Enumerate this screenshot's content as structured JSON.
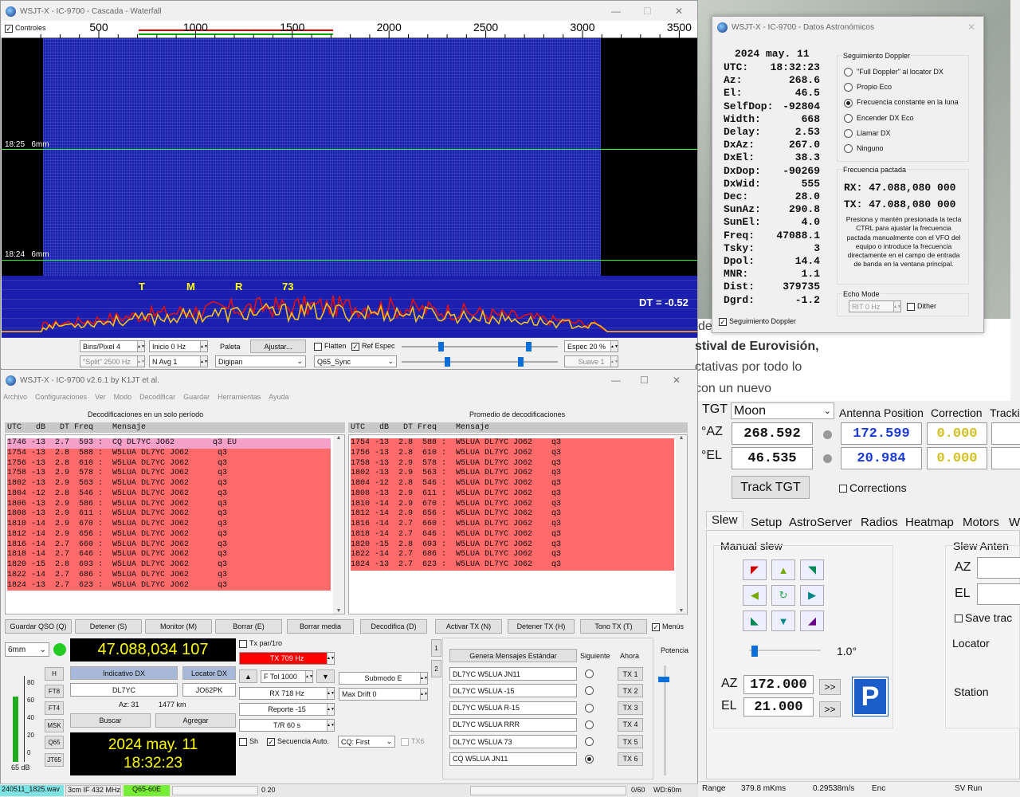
{
  "waterfall": {
    "title": "WSJT-X - IC-9700 - Cascada - Waterfall",
    "controls_label": "Controles",
    "freq_ticks": [
      "500",
      "1000",
      "1500",
      "2000",
      "2500",
      "3000",
      "3500"
    ],
    "time_marks": [
      {
        "time": "18:25",
        "band": "6mm"
      },
      {
        "time": "18:24",
        "band": "6mm"
      }
    ],
    "markers": [
      "T",
      "M",
      "R",
      "73"
    ],
    "dt_label": "DT =",
    "dt_value": "-0.52",
    "bins_pixel": "Bins/Pixel  4",
    "inicio": "Inicio 0 Hz",
    "split": "\"Split\"  2500  Hz",
    "navg": "N Avg 1",
    "paleta": "Paleta",
    "ajustar": "Ajustar...",
    "palette_value": "Digipan",
    "flatten": "Flatten",
    "ref_espec": "Ref Espec",
    "mode_value": "Q65_Sync",
    "espec": "Espec 20 %",
    "suave": "Suave  1",
    "colors": {
      "bg": "#1a1fae",
      "spectrum_red": "#e01010",
      "spectrum_yellow": "#f0c020"
    }
  },
  "astro": {
    "title": "WSJT-X - IC-9700 - Datos Astronómicos",
    "date": "2024 may. 11",
    "rows": [
      [
        "UTC:",
        "18:32:23"
      ],
      [
        "Az:",
        "268.6"
      ],
      [
        "El:",
        "46.5"
      ],
      [
        "SelfDop:",
        "-92804"
      ],
      [
        "Width:",
        "668"
      ],
      [
        "Delay:",
        "2.53"
      ],
      [
        "DxAz:",
        "267.0"
      ],
      [
        "DxEl:",
        "38.3"
      ],
      [
        "DxDop:",
        "-90269"
      ],
      [
        "DxWid:",
        "555"
      ],
      [
        "Dec:",
        "28.0"
      ],
      [
        "SunAz:",
        "290.8"
      ],
      [
        "SunEl:",
        "4.0"
      ],
      [
        "Freq:",
        "47088.1"
      ],
      [
        "Tsky:",
        "3"
      ],
      [
        "Dpol:",
        "14.4"
      ],
      [
        "MNR:",
        "1.1"
      ],
      [
        "Dist:",
        "379735"
      ],
      [
        "Dgrd:",
        "-1.2"
      ]
    ],
    "doppler_group": "Seguimiento Doppler",
    "doppler_options": [
      "\"Full Doppler\" al locator DX",
      "Propio Eco",
      "Frecuencia constante en la luna",
      "Encender DX Eco",
      "Llamar DX",
      "Ninguno"
    ],
    "doppler_selected": 2,
    "freq_group": "Frecuencia pactada",
    "rx": "RX: 47.088,080 000",
    "tx": "TX: 47.088,080 000",
    "note": "Presiona y mantén presionada la tecla CTRL para ajustar la frecuencia pactada manualmente con el VFO del equipo o introduce la frecuencia directamente en el campo de entrada de banda en la ventana principal.",
    "echo_group": "Echo Mode",
    "rit": "RIT  0  Hz",
    "dither": "Dither",
    "seguimiento": "Seguimiento Doppler"
  },
  "browser_text": {
    "lines": [
      "de",
      "stival de Eurovisión,",
      "ctativas por todo lo",
      "con un nuevo"
    ]
  },
  "main": {
    "title": "WSJT-X - IC-9700   v2.6.1   by K1JT et al.",
    "menu": [
      "Archivo",
      "Configuraciones",
      "Ver",
      "Modo",
      "Decodificar",
      "Guardar",
      "Herramientas",
      "Ayuda"
    ],
    "left_header": "Decodificaciones en un solo período",
    "right_header": "Promedio de decodificaciones",
    "col_header": "UTC   dB   DT Freq    Mensaje",
    "left_rows": [
      {
        "t": "1746 -13  2.7  593 :  CQ DL7YC JO62        q3 EU",
        "cq": true
      },
      {
        "t": "1754 -13  2.8  588 :  W5LUA DL7YC JO62      q3"
      },
      {
        "t": "1756 -13  2.8  610 :  W5LUA DL7YC JO62      q3"
      },
      {
        "t": "1758 -13  2.9  578 :  W5LUA DL7YC JO62      q3"
      },
      {
        "t": "1802 -13  2.9  563 :  W5LUA DL7YC JO62      q3"
      },
      {
        "t": "1804 -12  2.8  546 :  W5LUA DL7YC JO62      q3"
      },
      {
        "t": "1806 -13  2.9  586 :  W5LUA DL7YC JO62      q3"
      },
      {
        "t": "1808 -13  2.9  611 :  W5LUA DL7YC JO62      q3"
      },
      {
        "t": "1810 -14  2.9  670 :  W5LUA DL7YC JO62      q3"
      },
      {
        "t": "1812 -14  2.9  656 :  W5LUA DL7YC JO62      q3"
      },
      {
        "t": "1816 -14  2.7  660 :  W5LUA DL7YC JO62      q3"
      },
      {
        "t": "1818 -14  2.7  646 :  W5LUA DL7YC JO62      q3"
      },
      {
        "t": "1820 -15  2.8  693 :  W5LUA DL7YC JO62      q3"
      },
      {
        "t": "1822 -14  2.7  686 :  W5LUA DL7YC JO62      q3"
      },
      {
        "t": "1824 -13  2.7  623 :  W5LUA DL7YC JO62      q3"
      }
    ],
    "right_rows": [
      "1754 -13  2.8  588 :  W5LUA DL7YC JO62    q3",
      "1756 -13  2.8  610 :  W5LUA DL7YC JO62    q3",
      "1758 -13  2.9  578 :  W5LUA DL7YC JO62    q3",
      "1802 -13  2.9  563 :  W5LUA DL7YC JO62    q3",
      "1804 -12  2.8  546 :  W5LUA DL7YC JO62    q3",
      "1808 -13  2.9  611 :  W5LUA DL7YC JO62    q3",
      "1810 -14  2.9  670 :  W5LUA DL7YC JO62    q3",
      "1812 -14  2.9  656 :  W5LUA DL7YC JO62    q3",
      "1816 -14  2.7  660 :  W5LUA DL7YC JO62    q3",
      "1818 -14  2.7  646 :  W5LUA DL7YC JO62    q3",
      "1820 -15  2.8  693 :  W5LUA DL7YC JO62    q3",
      "1822 -14  2.7  686 :  W5LUA DL7YC JO62    q3",
      "1824 -13  2.7  623 :  W5LUA DL7YC JO62    q3"
    ],
    "buttons": [
      "Guardar QSO (Q)",
      "Detener (S)",
      "Monitor (M)",
      "Borrar (E)",
      "Borrar media",
      "Decodifica (D)",
      "Activar TX (N)",
      "Detener TX (H)",
      "Tono TX (T)"
    ],
    "menus_label": "Menús",
    "band": "6mm",
    "frequency": "47.088,034 107",
    "indicativo_dx": "Indicativo DX",
    "locator_dx": "Locator DX",
    "dx_call": "DL7YC",
    "dx_grid": "JO62PK",
    "az": "Az: 31",
    "km": "1477 km",
    "buscar": "Buscar",
    "agregar": "Agregar",
    "date": "2024 may. 11",
    "time": "18:32:23",
    "side_btns": [
      "H",
      "FT8",
      "FT4",
      "MSK",
      "Q65",
      "JT65"
    ],
    "meter_ticks": [
      "80",
      "60",
      "40",
      "20",
      "0"
    ],
    "meter_db": "65 dB",
    "tx_par": "Tx par/1ro",
    "tx_hz": "TX  709  Hz",
    "ftol": "F Tol  1000",
    "rx_hz": "RX  718  Hz",
    "reporte": "Reporte -15",
    "tr": "T/R  60  s",
    "submodo": "Submodo E",
    "maxdrift": "Max Drift  0",
    "sh": "Sh",
    "secuencia": "Secuencia Auto.",
    "cq_first": "CQ: First",
    "tx6_chk": "TX6",
    "tab1": "1",
    "tab2": "2",
    "genera": "Genera Mensajes Estándar",
    "siguiente": "Siguiente",
    "ahora": "Ahora",
    "messages": [
      "DL7YC W5LUA JN11",
      "DL7YC W5LUA -15",
      "DL7YC W5LUA R-15",
      "DL7YC W5LUA RRR",
      "DL7YC W5LUA 73",
      "CQ W5LUA JN11"
    ],
    "tx_btns": [
      "TX 1",
      "TX 2",
      "TX 3",
      "TX 4",
      "TX 5",
      "TX 6"
    ],
    "selected_msg": 5,
    "potencia": "Potencia",
    "status": {
      "file": "240511_1825.wav",
      "if": "3cm IF 432 MHz",
      "mode": "Q65-60E",
      "count": "0  20",
      "progress": "0/60",
      "wd": "WD:60m"
    }
  },
  "tracker": {
    "tgt_label": "TGT",
    "tgt_value": "Moon",
    "antenna_position": "Antenna Position",
    "correction": "Correction",
    "tracking": "Trackin",
    "az_label": "°AZ",
    "el_label": "°EL",
    "az_val": "268.592",
    "el_val": "46.535",
    "az_pos": "172.599",
    "el_pos": "20.984",
    "az_corr": "0.000",
    "el_corr": "0.000",
    "track_btn": "Track TGT",
    "corrections": "Corrections",
    "tabs": [
      "Slew",
      "Setup",
      "AstroServer",
      "Radios",
      "Heatmap",
      "Motors",
      "W"
    ],
    "manual_slew": "Manual slew",
    "step": "1.0°",
    "az_set": "172.000",
    "el_set": "21.000",
    "az_lbl": "AZ",
    "el_lbl": "EL",
    "slew_antenna": "Slew Anten",
    "save_track": "Save trac",
    "locator": "Locator",
    "station": "Station",
    "status": {
      "range_label": "Range",
      "range": "379.8 mKms",
      "rate": "0.29538m/s",
      "enc": "Enc",
      "sv": "SV Run"
    }
  }
}
